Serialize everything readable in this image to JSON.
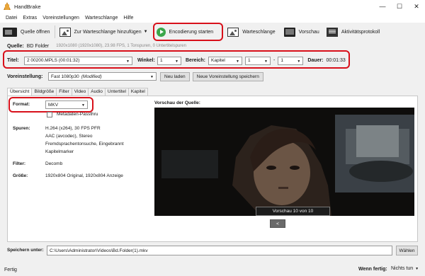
{
  "window": {
    "title": "HandBrake",
    "controls": {
      "minimize": "—",
      "maximize": "☐",
      "close": "✕"
    }
  },
  "menu": [
    "Datei",
    "Extras",
    "Voreinstellungen",
    "Warteschlange",
    "Hilfe"
  ],
  "toolbar": {
    "open_source": "Quelle öffnen",
    "add_queue": "Zur Warteschlange hinzufügen",
    "start": "Encodierung starten",
    "queue": "Warteschlange",
    "preview": "Vorschau",
    "activity": "Aktivitätsprotokoll"
  },
  "source": {
    "label": "Quelle:",
    "value": "BD Folder",
    "info": "1920x1080 (1920x1080), 23.98 FPS, 1 Tonspuren, 0 Untertitelspuren"
  },
  "title_row": {
    "title_label": "Titel:",
    "title_value": "2 00200.MPLS (00:01:32)",
    "angle_label": "Winkel:",
    "angle_value": "1",
    "range_label": "Bereich:",
    "range_type": "Kapitel",
    "range_start": "1",
    "range_dash": "-",
    "range_end": "1",
    "duration_label": "Dauer:",
    "duration_value": "00:01:33"
  },
  "preset": {
    "label": "Voreinstellung:",
    "value": "Fast 1080p30",
    "modified": "(Modified)",
    "reload": "Neu laden",
    "save_new": "Neue Voreinstellung speichern"
  },
  "tabs": [
    "Übersicht",
    "Bildgröße",
    "Filter",
    "Video",
    "Audio",
    "Untertitel",
    "Kapitel"
  ],
  "summary": {
    "format_label": "Format:",
    "format_value": "MKV",
    "metadata_passthru": "Metadaten-Passthru",
    "tracks_label": "Spuren:",
    "tracks": [
      "H.264 (x264), 30 FPS PFR",
      "AAC (avcodec), Stereo",
      "Fremdsprachentonsuche, Eingebrannt",
      "Kapitelmarker"
    ],
    "filter_label": "Filter:",
    "filter_value": "Decomb",
    "size_label": "Größe:",
    "size_value": "1920x804 Original, 1920x804 Anzeige"
  },
  "preview": {
    "label": "Vorschau der Quelle:",
    "caption": "Vorschau 10 von 10",
    "back": "<"
  },
  "save": {
    "label": "Speichern unter:",
    "path": "C:\\Users\\Administrator\\Videos\\Bd.Folder(1).mkv",
    "browse": "Wählen"
  },
  "status": {
    "left": "Fertig",
    "when_done_label": "Wenn fertig:",
    "when_done_value": "Nichts tun"
  },
  "colors": {
    "highlight": "#d8101a",
    "start_green": "#3aa64a"
  }
}
